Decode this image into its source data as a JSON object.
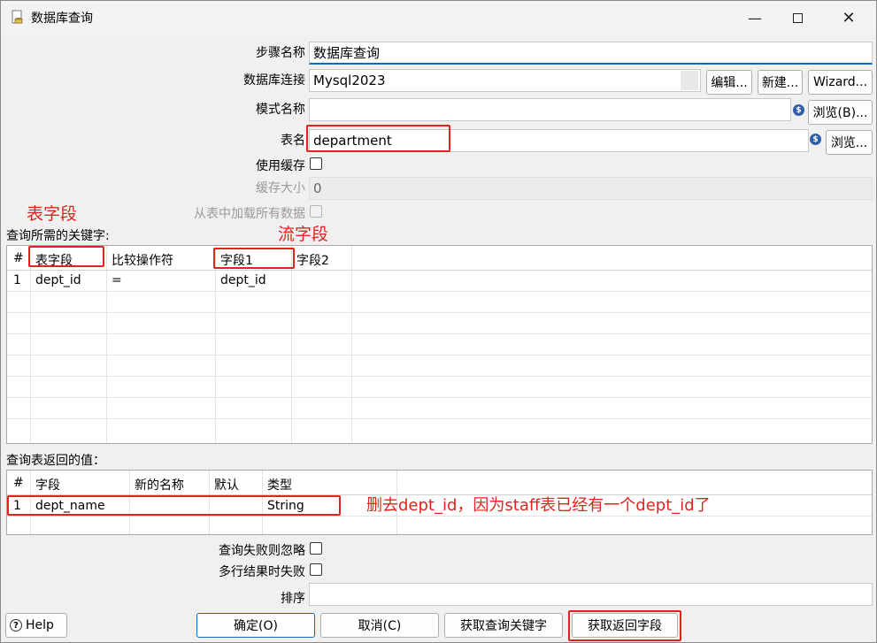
{
  "window": {
    "title": "数据库查询"
  },
  "form": {
    "step_name_label": "步骤名称",
    "step_name_value": "数据库查询",
    "connection_label": "数据库连接",
    "connection_value": "Mysql2023",
    "edit_button": "编辑...",
    "new_button": "新建...",
    "wizard_button": "Wizard...",
    "schema_label": "模式名称",
    "schema_value": "",
    "browse_b_button": "浏览(B)...",
    "table_label": "表名",
    "table_value": "department",
    "browse_button": "浏览...",
    "use_cache_label": "使用缓存",
    "cache_size_label": "缓存大小",
    "cache_size_value": "0",
    "load_all_label": "从表中加载所有数据"
  },
  "keys_section": {
    "label": "查询所需的关键字:",
    "headers": [
      "#",
      "表字段",
      "比较操作符",
      "字段1",
      "字段2"
    ],
    "rows": [
      [
        "1",
        "dept_id",
        "=",
        "dept_id",
        ""
      ]
    ]
  },
  "return_section": {
    "label": "查询表返回的值：",
    "headers": [
      "#",
      "字段",
      "新的名称",
      "默认",
      "类型"
    ],
    "rows": [
      [
        "1",
        "dept_name",
        "",
        "",
        "String"
      ]
    ]
  },
  "options": {
    "ignore_fail_label": "查询失败则忽略",
    "fail_multi_label": "多行结果时失败",
    "order_label": "排序",
    "order_value": ""
  },
  "footer": {
    "help": "Help",
    "ok": "确定(O)",
    "cancel": "取消(C)",
    "get_keys": "获取查询关键字",
    "get_fields": "获取返回字段"
  },
  "annotations": {
    "table_field": "表字段",
    "stream_field": "流字段",
    "note": "删去dept_id，因为staff表已经有一个dept_id了"
  },
  "colors": {
    "annotation_red": "#e0231c",
    "accent_blue": "#0f6cbd"
  }
}
